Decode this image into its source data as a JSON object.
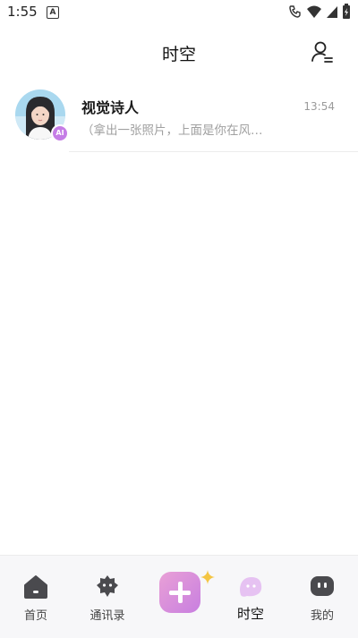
{
  "status_bar": {
    "time": "1:55",
    "a_icon": "A"
  },
  "header": {
    "title": "时空",
    "contacts_icon": "user-list-icon"
  },
  "conversations": [
    {
      "name": "视觉诗人",
      "time": "13:54",
      "preview": "（拿出一张照片，上面是你在风…",
      "badge": "AI"
    }
  ],
  "tabbar": {
    "tabs": [
      {
        "label": "首页",
        "icon": "home-icon",
        "active": false
      },
      {
        "label": "通讯录",
        "icon": "contacts-icon",
        "active": false
      },
      {
        "label": "",
        "icon": "plus-icon",
        "active": false
      },
      {
        "label": "时空",
        "icon": "ghost-icon",
        "active": true
      },
      {
        "label": "我的",
        "icon": "chat-bubble-icon",
        "active": false
      }
    ]
  },
  "colors": {
    "accent": "#c57de6",
    "create_gradient_start": "#e9a0d6",
    "create_gradient_end": "#c87fe0",
    "sparkle": "#f4c542"
  }
}
